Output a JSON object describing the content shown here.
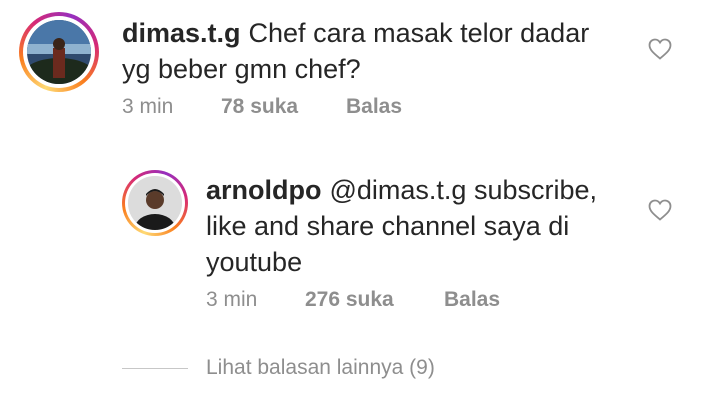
{
  "comments": [
    {
      "username": "dimas.t.g",
      "text": "Chef cara masak telor dadar yg beber gmn chef?",
      "line1": "Chef cara masak telor dadar",
      "line2": "yg beber gmn chef?",
      "time": "3 min",
      "likes": "78 suka",
      "reply": "Balas",
      "heart_icon": "heart-outline-icon"
    },
    {
      "username": "arnoldpo",
      "mention": "@dimas.t.g",
      "line1_rest": "subscribe,",
      "line2": "like and share channel saya di",
      "line3": "youtube",
      "time": "3 min",
      "likes": "276 suka",
      "reply": "Balas",
      "heart_icon": "heart-outline-icon"
    }
  ],
  "view_more": "Lihat balasan lainnya (9)",
  "colors": {
    "text": "#262626",
    "muted": "#8e8e8e",
    "divider": "#c7c7c7"
  }
}
